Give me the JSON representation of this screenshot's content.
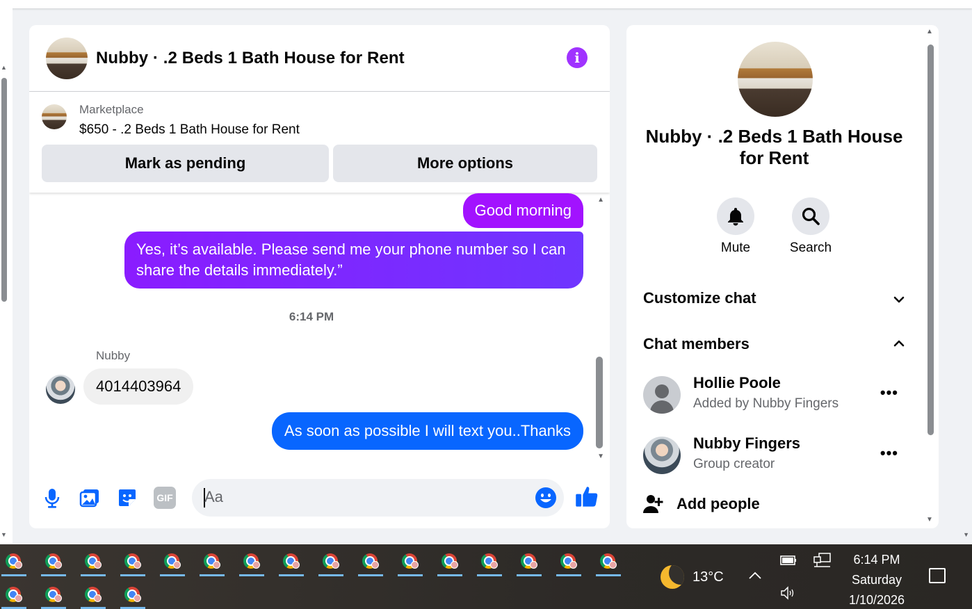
{
  "chat": {
    "title": "Nubby · .2 Beds 1 Bath House for Rent",
    "marketplace": {
      "label": "Marketplace",
      "listing": "$650 - .2 Beds 1 Bath House for Rent",
      "mark_pending_label": "Mark as pending",
      "more_options_label": "More options"
    },
    "messages": {
      "outgoing_1": "Good morning",
      "outgoing_2": "Yes, it’s available. Please send me your phone number so I can share the details immediately.”",
      "timestamp": "6:14 PM",
      "incoming_sender": "Nubby",
      "incoming_1": "4014403964",
      "outgoing_3": "As soon as possible I will text you..Thanks"
    },
    "composer": {
      "placeholder": "Aa",
      "gif_label": "GIF"
    }
  },
  "info_panel": {
    "name": "Nubby · .2 Beds 1 Bath House for Rent",
    "actions": {
      "mute_label": "Mute",
      "search_label": "Search"
    },
    "customize_chat_label": "Customize chat",
    "chat_members_label": "Chat members",
    "members": [
      {
        "name": "Hollie Poole",
        "subtitle": "Added by Nubby Fingers"
      },
      {
        "name": "Nubby Fingers",
        "subtitle": "Group creator"
      }
    ],
    "more_label": "•••",
    "add_people_label": "Add people"
  },
  "taskbar": {
    "app_icons": "chrome-icon",
    "row1_count": 16,
    "row2_count": 4,
    "weather": "13°C",
    "time": "6:14 PM",
    "day": "Saturday",
    "date": "1/10/2026"
  },
  "colors": {
    "accent_purple": "#a033ff",
    "messenger_blue": "#0866ff",
    "bubble_purple": "#a212ff"
  }
}
